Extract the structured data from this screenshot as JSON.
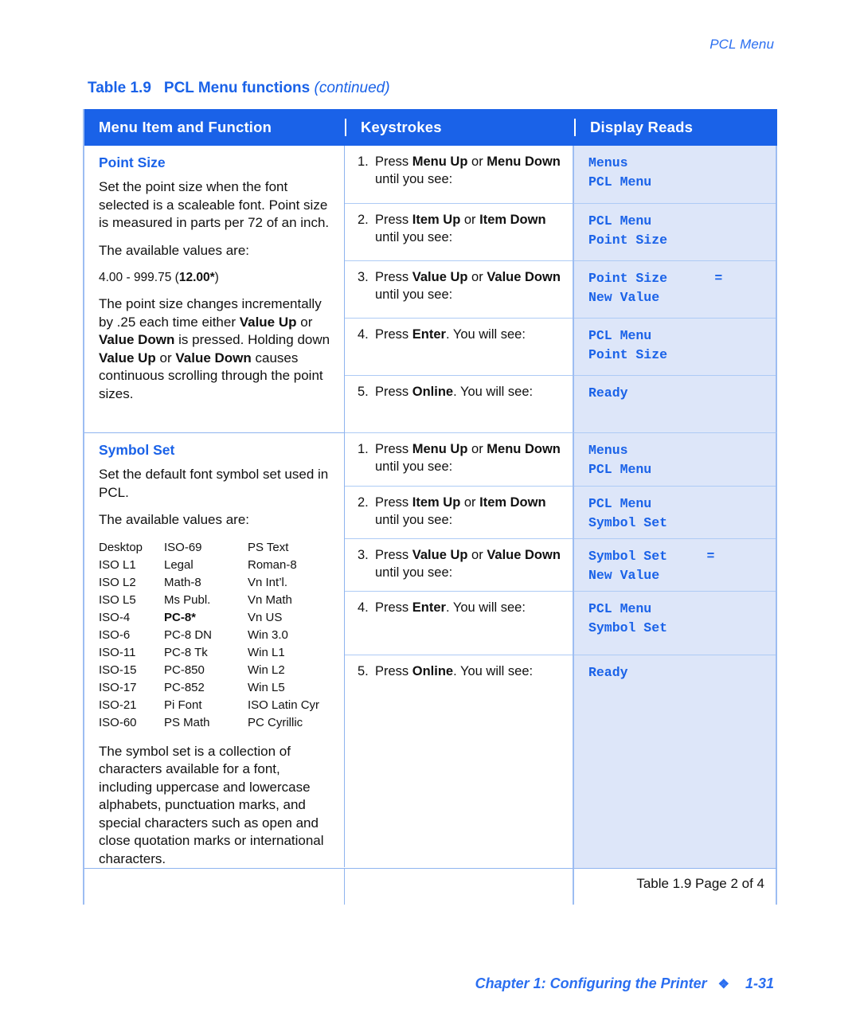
{
  "running_head": "PCL Menu",
  "table_caption": {
    "number": "Table 1.9",
    "title": "PCL Menu functions",
    "continued": "(continued)"
  },
  "colors": {
    "header_blue": "#1a62e8",
    "display_cell_bg": "#dde6f9",
    "grid_blue": "#9dbdf2",
    "accent_text": "#2a6ef0"
  },
  "columns": {
    "menu_item": "Menu Item and Function",
    "keystrokes": "Keystrokes",
    "display_reads": "Display Reads"
  },
  "sections": [
    {
      "title": "Point Size",
      "paragraphs": [
        "Set the point size when the font selected is a scaleable font. Point size is measured in parts per 72 of an inch.",
        "The available values are:"
      ],
      "value_range_prefix": "4.00 - 999.75 (",
      "value_range_default": "12.00*",
      "value_range_suffix": ")",
      "closing_paragraph_parts": [
        "The point size changes incrementally by .25 each time either ",
        "Value Up",
        " or ",
        "Value Down",
        " is pressed. Holding down ",
        "Value Up",
        " or ",
        "Value Down",
        " causes continuous scrolling through the point sizes."
      ],
      "steps": [
        {
          "number": "1.",
          "parts": [
            "Press ",
            "Menu Up",
            " or ",
            "Menu Down",
            " until you see:"
          ],
          "display_line1": "Menus",
          "display_line2": "PCL Menu",
          "display_line2_italic": false
        },
        {
          "number": "2.",
          "parts": [
            "Press ",
            "Item Up",
            " or ",
            "Item Down",
            " until you see:"
          ],
          "display_line1": "PCL Menu",
          "display_line2": "Point Size",
          "display_line2_italic": false
        },
        {
          "number": "3.",
          "parts": [
            "Press ",
            "Value Up",
            " or ",
            "Value Down",
            " until you see:"
          ],
          "display_line1": "Point Size      =",
          "display_line2": "New Value",
          "display_line2_italic": true
        },
        {
          "number": "4.",
          "parts": [
            "Press ",
            "Enter",
            ". You will see:"
          ],
          "display_line1": "PCL Menu",
          "display_line2": "Point Size",
          "display_line2_italic": false
        },
        {
          "number": "5.",
          "parts": [
            "Press ",
            "Online",
            ". You will see:"
          ],
          "display_line1": "Ready",
          "display_line2": "",
          "display_line2_italic": false
        }
      ]
    },
    {
      "title": "Symbol Set",
      "paragraphs": [
        "Set the default font symbol set used in PCL.",
        "The available values are:"
      ],
      "values_grid": [
        [
          "Desktop",
          "ISO-69",
          "PS Text"
        ],
        [
          "ISO L1",
          "Legal",
          "Roman-8"
        ],
        [
          "ISO L2",
          "Math-8",
          "Vn Int’l."
        ],
        [
          "ISO L5",
          "Ms Publ.",
          "Vn Math"
        ],
        [
          "ISO-4",
          "PC-8*",
          "Vn US"
        ],
        [
          "ISO-6",
          "PC-8 DN",
          "Win 3.0"
        ],
        [
          "ISO-11",
          "PC-8 Tk",
          "Win L1"
        ],
        [
          "ISO-15",
          "PC-850",
          "Win L2"
        ],
        [
          "ISO-17",
          "PC-852",
          "Win L5"
        ],
        [
          "ISO-21",
          "Pi Font",
          "ISO Latin Cyr"
        ],
        [
          "ISO-60",
          "PS Math",
          "PC Cyrillic"
        ]
      ],
      "values_grid_bold_cell": "PC-8*",
      "closing_paragraph": "The symbol set is a collection of characters available for a font, including uppercase and lowercase alphabets, punctuation marks, and special characters such as open and close quotation marks or international characters.",
      "steps": [
        {
          "number": "1.",
          "parts": [
            "Press ",
            "Menu Up",
            " or ",
            "Menu Down",
            " until you see:"
          ],
          "display_line1": "Menus",
          "display_line2": "PCL Menu",
          "display_line2_italic": false
        },
        {
          "number": "2.",
          "parts": [
            "Press ",
            "Item Up",
            " or ",
            "Item Down",
            " until you see:"
          ],
          "display_line1": "PCL Menu",
          "display_line2": "Symbol Set",
          "display_line2_italic": false
        },
        {
          "number": "3.",
          "parts": [
            "Press ",
            "Value Up",
            " or ",
            "Value Down",
            " until you see:"
          ],
          "display_line1": "Symbol Set     =",
          "display_line2": "New Value",
          "display_line2_italic": true
        },
        {
          "number": "4.",
          "parts": [
            "Press ",
            "Enter",
            ". You will see:"
          ],
          "display_line1": "PCL Menu",
          "display_line2": "Symbol Set",
          "display_line2_italic": false
        },
        {
          "number": "5.",
          "parts": [
            "Press ",
            "Online",
            ". You will see:"
          ],
          "display_line1": "Ready",
          "display_line2": "",
          "display_line2_italic": false
        }
      ]
    }
  ],
  "table_footer": "Table 1.9  Page 2 of 4",
  "page_footer": {
    "chapter": "Chapter 1: Configuring the Printer",
    "diamond": "❖",
    "page_number": "1-31"
  }
}
